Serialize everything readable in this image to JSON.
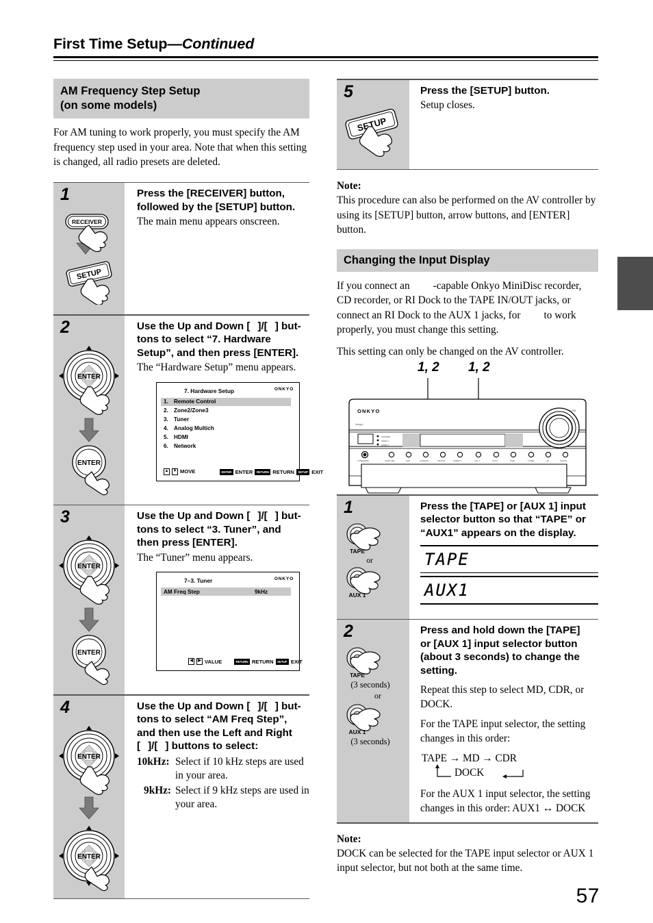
{
  "header": {
    "title_main": "First Time Setup",
    "title_cont": "—Continued"
  },
  "left_column": {
    "section_heading_line1": "AM Frequency Step Setup",
    "section_heading_line2": "(on some models)",
    "intro": "For AM tuning to work properly, you must specify the AM frequency step used in your area. Note that when this setting is changed, all radio presets are deleted.",
    "steps": [
      {
        "num": "1",
        "title_a": "Press the [RECEIVER] button,",
        "title_b": "followed by the [SETUP] button.",
        "desc": "The main menu appears onscreen.",
        "button_labels": [
          "RECEIVER",
          "SETUP"
        ]
      },
      {
        "num": "2",
        "title_a": "Use the Up and Down [",
        "title_b": "]/[",
        "title_c": "] but-",
        "title_d": "tons to select “7. Hardware",
        "title_e": "Setup”, and then press [ENTER].",
        "desc": "The “Hardware Setup” menu appears.",
        "button_labels": [
          "ENTER",
          "ENTER"
        ]
      },
      {
        "num": "3",
        "title_a": "Use the Up and Down [",
        "title_b": "]/[",
        "title_c": "] but-",
        "title_d": "tons to select “3. Tuner”, and",
        "title_e": "then press [ENTER].",
        "desc": "The “Tuner” menu appears.",
        "button_labels": [
          "ENTER",
          "ENTER"
        ]
      },
      {
        "num": "4",
        "title_a": "Use the Up and Down [",
        "title_b": "]/[",
        "title_c": "] but-",
        "title_d": "tons to select “AM Freq Step”,",
        "title_e": "and then use the Left and Right",
        "title_f": "[",
        "title_g": "]/[",
        "title_h": "] buttons to select:",
        "options": [
          {
            "label": "10kHz:",
            "text": "Select if 10 kHz steps are used in your area."
          },
          {
            "label": "9kHz:",
            "text": "Select if 9 kHz steps are used in your area."
          }
        ],
        "button_labels": [
          "ENTER",
          "ENTER"
        ]
      }
    ],
    "osd_hardware": {
      "brand": "ONKYO",
      "title": "7.   Hardware Setup",
      "items": [
        {
          "n": "1.",
          "label": "Remote Control"
        },
        {
          "n": "2.",
          "label": "Zone2/Zone3"
        },
        {
          "n": "3.",
          "label": "Tuner"
        },
        {
          "n": "4.",
          "label": "Analog Multich"
        },
        {
          "n": "5.",
          "label": "HDMI"
        },
        {
          "n": "6.",
          "label": "Network"
        }
      ],
      "footer_move": "MOVE",
      "footer_enter_key": "ENTER",
      "footer_enter": "ENTER",
      "footer_return_key": "RETURN",
      "footer_return": "RETURN",
      "footer_exit_key": "SETUP",
      "footer_exit": "EXIT"
    },
    "osd_tuner": {
      "brand": "ONKYO",
      "title": "7–3.   Tuner",
      "row_label": "AM Freq Step",
      "row_value": "9kHz",
      "footer_value": "VALUE",
      "footer_return_key": "RETURN",
      "footer_return": "RETURN",
      "footer_exit_key": "SETUP",
      "footer_exit": "EXIT"
    }
  },
  "right_column": {
    "step5": {
      "num": "5",
      "title": "Press the [SETUP] button.",
      "desc": "Setup closes.",
      "button_label": "SETUP"
    },
    "note1_label": "Note:",
    "note1_text": "This procedure can also be performed on the AV controller by using its [SETUP] button, arrow buttons, and [ENTER] button.",
    "section_heading": "Changing the Input Display",
    "intro_a": "If you connect an",
    "intro_b": "-capable Onkyo MiniDisc recorder, CD recorder, or RI Dock to the TAPE IN/OUT jacks, or connect an RI Dock to the AUX 1 jacks, for",
    "intro_c": "to work properly, you must change this setting.",
    "intro2": "This setting can only be changed on the AV controller.",
    "receiver": {
      "callout_left": "1, 2",
      "callout_right": "1, 2",
      "brand": "ONKYO"
    },
    "steps": [
      {
        "num": "1",
        "title_a": "Press the [TAPE] or [AUX 1] input",
        "title_b": "selector button so that “TAPE” or",
        "title_c": "“AUX1” appears on the display.",
        "button_a": "TAPE",
        "or": "or",
        "button_b": "AUX 1",
        "display_a": "TAPE",
        "display_b": "AUX1"
      },
      {
        "num": "2",
        "title_a": "Press and hold down the [TAPE]",
        "title_b": "or [AUX 1] input selector button",
        "title_c": "(about 3 seconds) to change the",
        "title_d": "setting.",
        "button_a": "TAPE",
        "hold_a": "(3 seconds)",
        "or": "or",
        "button_b": "AUX 1",
        "hold_b": "(3 seconds)",
        "desc1": "Repeat this step to select MD, CDR, or DOCK.",
        "desc2": "For the TAPE input selector, the setting changes in this order:",
        "cycle_top": "TAPE → MD → CDR",
        "cycle_bottom": "DOCK",
        "desc3": "For the AUX 1 input selector, the setting changes in this order: AUX1 ↔ DOCK"
      }
    ],
    "note2_label": "Note:",
    "note2_text": "DOCK can be selected for the TAPE input selector or AUX 1 input selector, but not both at the same time."
  },
  "page_number": "57",
  "colors": {
    "section_bar": "#cccccc",
    "step_cell": "#cccccc",
    "margin_tab": "#4d4d4d",
    "rule": "#555555",
    "osd_highlight": "#c8c8c8"
  }
}
